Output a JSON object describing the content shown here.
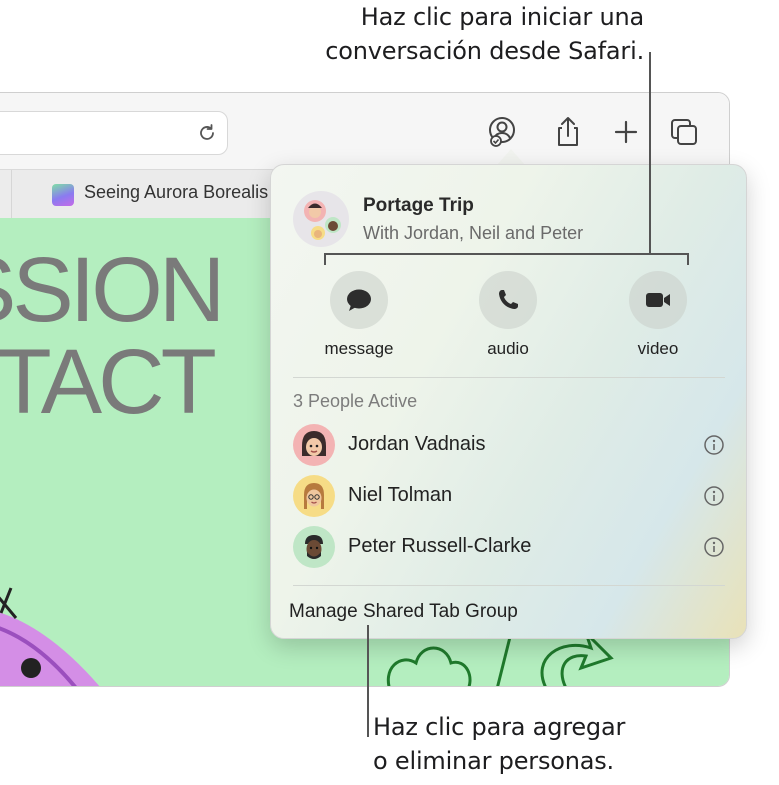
{
  "callouts": {
    "top_line1": "Haz clic para iniciar una",
    "top_line2": "conversación desde Safari.",
    "bottom_line1": "Haz clic para agregar",
    "bottom_line2": "o eliminar personas."
  },
  "browser": {
    "tab_title": "Seeing Aurora Borealis",
    "page_text_line1": "SSION",
    "page_text_line2": "NTACT"
  },
  "popover": {
    "group_title": "Portage Trip",
    "group_subtitle": "With Jordan, Neil and Peter",
    "actions": [
      {
        "label": "message",
        "icon": "message-bubble-icon"
      },
      {
        "label": "audio",
        "icon": "phone-icon"
      },
      {
        "label": "video",
        "icon": "video-camera-icon"
      }
    ],
    "section_header": "3 People Active",
    "people": [
      {
        "name": "Jordan Vadnais",
        "avatar_color": "#f3b3b3"
      },
      {
        "name": "Niel Tolman",
        "avatar_color": "#f6dc86"
      },
      {
        "name": "Peter Russell-Clarke",
        "avatar_color": "#bfe6c6"
      }
    ],
    "manage_label": "Manage Shared Tab Group"
  },
  "colors": {
    "page_background": "#b4eebf",
    "icon_gray": "#555555"
  }
}
